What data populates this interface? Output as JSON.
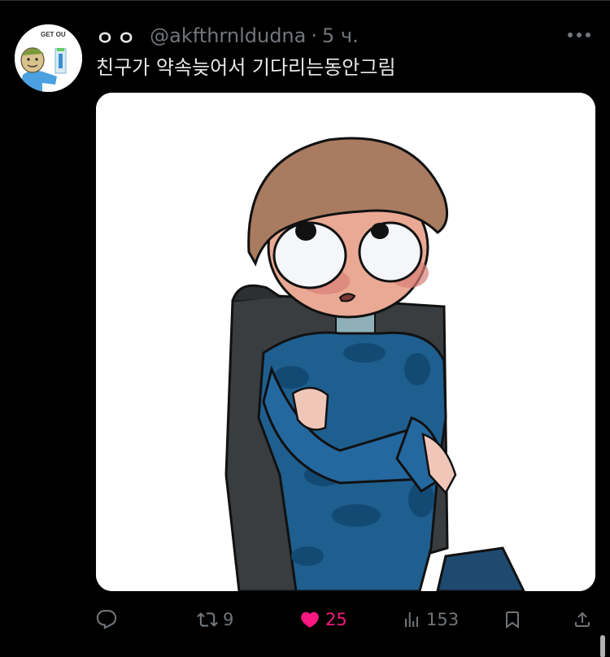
{
  "post": {
    "display_name": "ㅇㅇ",
    "handle": "@akfthrnldudna",
    "separator": "·",
    "time": "5 ч.",
    "text": "친구가 약속늦어서 기다리는동안그림",
    "avatar_sign_text": "GET OU"
  },
  "actions": {
    "reply": {
      "icon": "reply-icon",
      "count": ""
    },
    "repost": {
      "icon": "repost-icon",
      "count": "9"
    },
    "like": {
      "icon": "heart-icon",
      "count": "25",
      "liked": true,
      "color": "#f91880"
    },
    "views": {
      "icon": "views-icon",
      "count": "153"
    },
    "bookmark": {
      "icon": "bookmark-icon"
    },
    "share": {
      "icon": "share-icon"
    }
  },
  "colors": {
    "background": "#000000",
    "text": "#e7e9ea",
    "muted": "#71767b",
    "like_active": "#f91880"
  }
}
